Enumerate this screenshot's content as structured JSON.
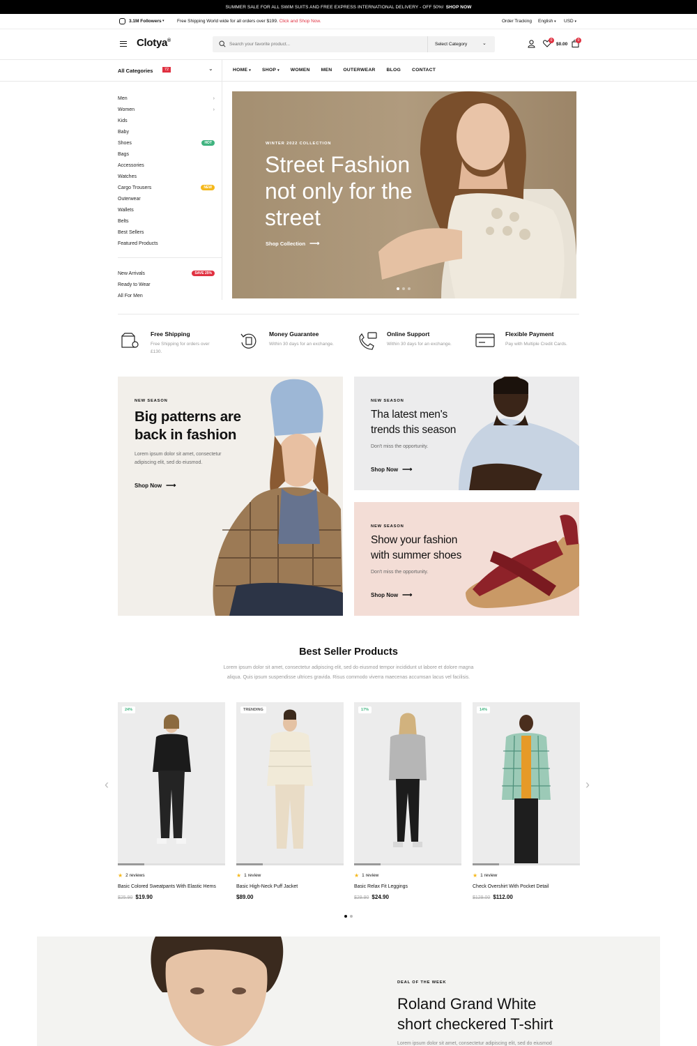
{
  "topbar": {
    "text": "SUMMER SALE FOR ALL SWIM SUITS AND FREE EXPRESS INTERNATIONAL DELIVERY - OFF 50%!",
    "link": "SHOP NOW"
  },
  "infobar": {
    "followers": "3.1M Followers",
    "shipping_text": "Free Shipping World wide for all orders over $199.",
    "shipping_link": "Click and Shop Now.",
    "order_tracking": "Order Tracking",
    "language": "English",
    "currency": "USD"
  },
  "header": {
    "logo": "Clotya",
    "logo_mark": "®",
    "search_placeholder": "Search your favorite product...",
    "category_select": "Select Category",
    "wishlist_count": "0",
    "cart_total": "$0.00",
    "cart_count": "0"
  },
  "nav": {
    "all_categories": "All Categories",
    "categories_count": "72",
    "items": [
      "HOME",
      "SHOP",
      "WOMEN",
      "MEN",
      "OUTERWEAR",
      "BLOG",
      "CONTACT"
    ]
  },
  "sidebar": {
    "items": [
      {
        "label": "Men",
        "badge": ""
      },
      {
        "label": "Women",
        "badge": ""
      },
      {
        "label": "Kids",
        "badge": ""
      },
      {
        "label": "Baby",
        "badge": ""
      },
      {
        "label": "Shoes",
        "badge": "HOT"
      },
      {
        "label": "Bags",
        "badge": ""
      },
      {
        "label": "Accessories",
        "badge": ""
      },
      {
        "label": "Watches",
        "badge": ""
      },
      {
        "label": "Cargo Trousers",
        "badge": "NEW"
      },
      {
        "label": "Outerwear",
        "badge": ""
      },
      {
        "label": "Wallets",
        "badge": ""
      },
      {
        "label": "Belts",
        "badge": ""
      },
      {
        "label": "Best Sellers",
        "badge": ""
      },
      {
        "label": "Featured Products",
        "badge": ""
      }
    ],
    "extra": [
      {
        "label": "New Arrivals",
        "badge": "SAVE 25%"
      },
      {
        "label": "Ready to Wear",
        "badge": ""
      },
      {
        "label": "All For Men",
        "badge": ""
      }
    ]
  },
  "hero": {
    "kicker": "WINTER 2022 COLLECTION",
    "line1": "Street Fashion",
    "line2": "not only for the",
    "line3": "street",
    "cta": "Shop Collection"
  },
  "features": [
    {
      "title": "Free Shipping",
      "sub": "Free Shipping for orders over £130.",
      "icon": "box-icon"
    },
    {
      "title": "Money Guarantee",
      "sub": "Within 30 days for an exchange.",
      "icon": "refund-icon"
    },
    {
      "title": "Online Support",
      "sub": "Within 30 days for an exchange.",
      "icon": "phone-icon"
    },
    {
      "title": "Flexible Payment",
      "sub": "Pay with Multiple Credit Cards.",
      "icon": "card-icon"
    }
  ],
  "banners": {
    "left": {
      "kicker": "NEW SEASON",
      "line1": "Big patterns are",
      "line2": "back in fashion",
      "text1": "Lorem ipsum dolor sit amet, consectetur",
      "text2": "adipiscing elit, sed do eiusmod.",
      "cta": "Shop Now"
    },
    "top_right": {
      "kicker": "NEW SEASON",
      "line1": "Tha latest men's",
      "line2": "trends this season",
      "text1": "Don't miss the opportunity.",
      "cta": "Shop Now"
    },
    "bottom_right": {
      "kicker": "NEW SEASON",
      "line1": "Show your fashion",
      "line2": "with summer shoes",
      "text1": "Don't miss the opportunity.",
      "cta": "Shop Now"
    }
  },
  "bestsellers": {
    "title": "Best Seller Products",
    "desc1": "Lorem ipsum dolor sit amet, consectetur adipiscing elit, sed do eiusmod tempor incididunt ut labore et dolore magna",
    "desc2": "aliqua. Quis ipsum suspendisse ultrices gravida. Risus commodo viverra maecenas accumsan lacus vel facilisis.",
    "products": [
      {
        "tag": "24%",
        "reviews": "2 reviews",
        "name": "Basic Colored Sweatpants With Elastic Hems",
        "old_price": "$25.90",
        "price": "$19.90"
      },
      {
        "tag": "TRENDING",
        "reviews": "1 review",
        "name": "Basic High-Neck Puff Jacket",
        "old_price": "",
        "price": "$89.00"
      },
      {
        "tag": "17%",
        "reviews": "1 review",
        "name": "Basic Relax Fit Leggings",
        "old_price": "$29.90",
        "price": "$24.90"
      },
      {
        "tag": "14%",
        "reviews": "1 review",
        "name": "Check Overshirt With Pocket Detail",
        "old_price": "$129.00",
        "price": "$112.00"
      }
    ]
  },
  "deal": {
    "kicker": "DEAL OF THE WEEK",
    "line1": "Roland Grand White",
    "line2": "short checkered T-shirt",
    "text": "Lorem ipsum dolor sit amet, consectetur adipiscing elit, sed do eiusmod"
  },
  "colors": {
    "accent_red": "#e03141",
    "hot_green": "#3fb37f",
    "new_yellow": "#f5b81b",
    "star": "#f5b81b"
  }
}
